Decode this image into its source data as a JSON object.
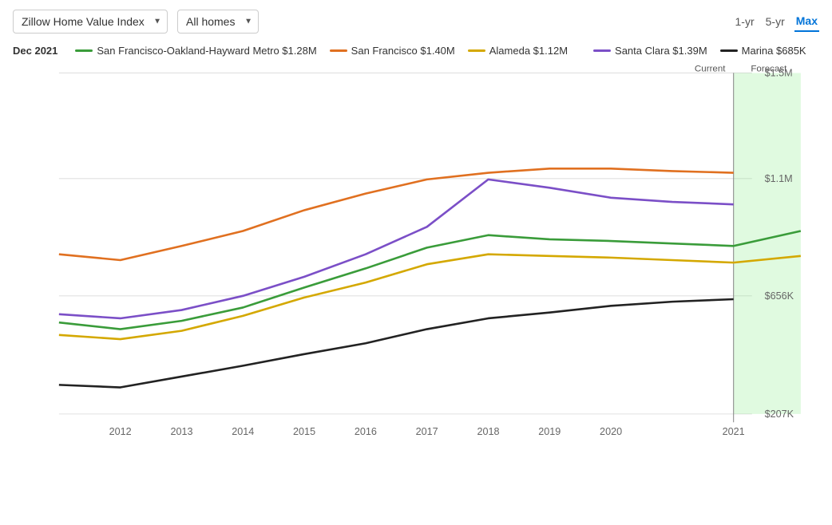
{
  "toolbar": {
    "index_label": "Zillow Home Value Index",
    "home_type_label": "All homes",
    "time_buttons": [
      {
        "label": "1-yr",
        "key": "1yr",
        "active": false
      },
      {
        "label": "5-yr",
        "key": "5yr",
        "active": false
      },
      {
        "label": "Max",
        "key": "max",
        "active": true
      }
    ]
  },
  "legend": {
    "date": "Dec 2021",
    "items": [
      {
        "label": "San Francisco-Oakland-Hayward Metro $1.28M",
        "color": "#3a9c3a"
      },
      {
        "label": "San Francisco $1.40M",
        "color": "#e07020"
      },
      {
        "label": "Alameda $1.12M",
        "color": "#d4a800"
      },
      {
        "label": "Santa Clara $1.39M",
        "color": "#7b4fc7"
      },
      {
        "label": "Marina $685K",
        "color": "#222"
      }
    ]
  },
  "chart": {
    "y_labels": [
      "$1.5M",
      "$1.1M",
      "$656K",
      "$207K"
    ],
    "x_labels": [
      "2012",
      "2013",
      "2014",
      "2015",
      "2016",
      "2017",
      "2018",
      "2019",
      "2020",
      "2021"
    ],
    "current_label": "Current",
    "forecast_label": "Forecast",
    "colors": {
      "sf_metro": "#3a9c3a",
      "san_francisco": "#e07020",
      "alameda": "#d4a800",
      "santa_clara": "#7b4fc7",
      "marina": "#222222",
      "forecast_bg": "rgba(144,238,144,0.3)",
      "grid": "#e8e8e8"
    }
  }
}
